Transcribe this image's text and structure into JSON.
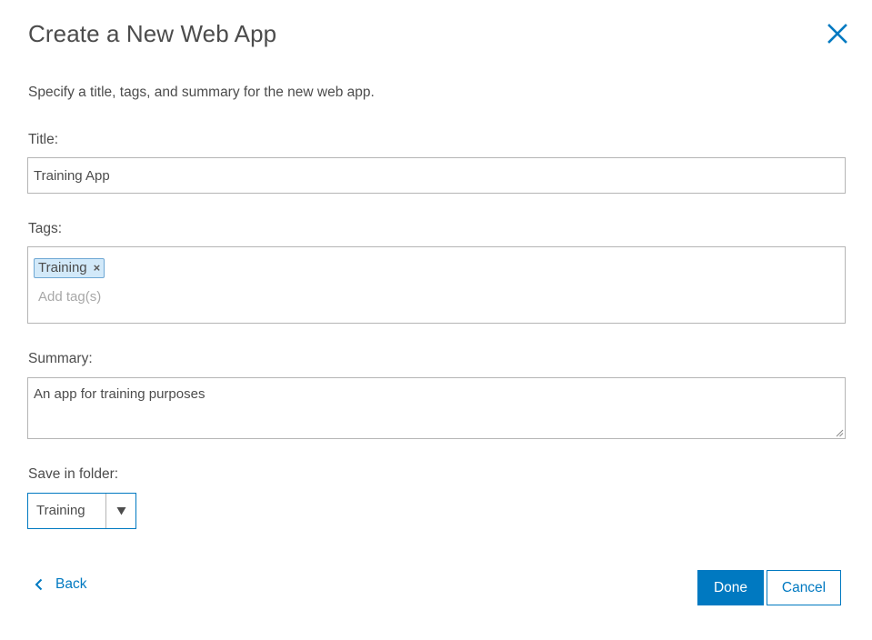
{
  "dialog": {
    "title": "Create a New Web App",
    "instructions": "Specify a title, tags, and summary for the new web app."
  },
  "fields": {
    "title": {
      "label": "Title:",
      "value": "Training App"
    },
    "tags": {
      "label": "Tags:",
      "items": [
        "Training"
      ],
      "remove_glyph": "×",
      "placeholder": "Add tag(s)"
    },
    "summary": {
      "label": "Summary:",
      "value": "An app for training purposes"
    },
    "folder": {
      "label": "Save in folder:",
      "selected": "Training"
    }
  },
  "footer": {
    "back_label": "Back",
    "done_label": "Done",
    "cancel_label": "Cancel"
  },
  "icons": {
    "close": "close-icon",
    "dropdown": "caret-down-icon",
    "back": "chevron-left-icon"
  },
  "colors": {
    "accent": "#0079c1",
    "tag_bg": "#d2e9f9",
    "text": "#4c4c4c",
    "border": "#b5b5b5"
  }
}
